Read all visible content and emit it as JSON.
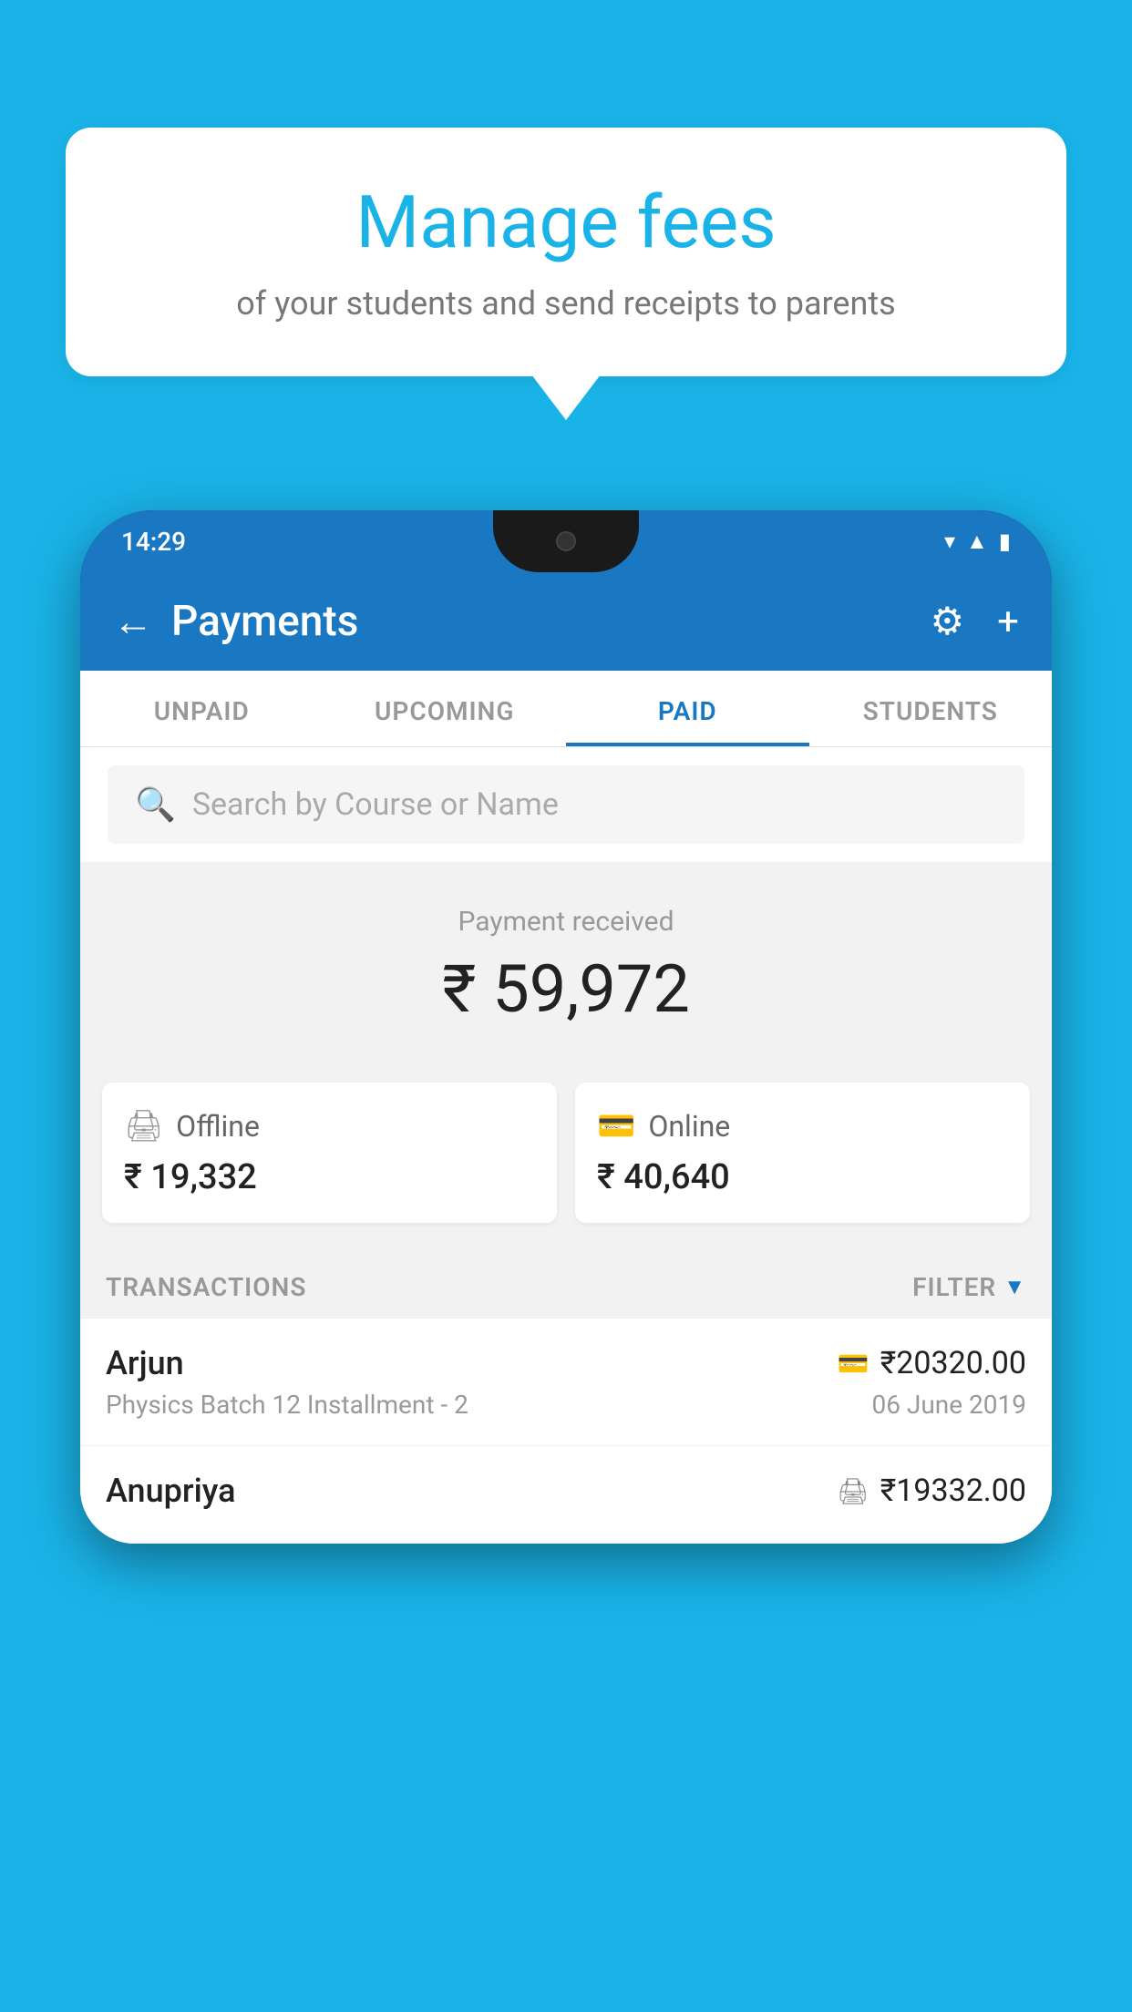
{
  "background_color": "#1ab3e8",
  "speech_bubble": {
    "title": "Manage fees",
    "subtitle": "of your students and send receipts to parents"
  },
  "status_bar": {
    "time": "14:29"
  },
  "header": {
    "title": "Payments",
    "back_label": "←",
    "settings_label": "⚙",
    "plus_label": "+"
  },
  "tabs": [
    {
      "label": "UNPAID",
      "active": false
    },
    {
      "label": "UPCOMING",
      "active": false
    },
    {
      "label": "PAID",
      "active": true
    },
    {
      "label": "STUDENTS",
      "active": false
    }
  ],
  "search": {
    "placeholder": "Search by Course or Name"
  },
  "payment_summary": {
    "label": "Payment received",
    "amount": "₹ 59,972",
    "offline_label": "Offline",
    "offline_amount": "₹ 19,332",
    "online_label": "Online",
    "online_amount": "₹ 40,640"
  },
  "transactions": {
    "section_label": "TRANSACTIONS",
    "filter_label": "FILTER",
    "rows": [
      {
        "name": "Arjun",
        "amount": "₹20320.00",
        "detail": "Physics Batch 12 Installment - 2",
        "date": "06 June 2019",
        "payment_type": "online"
      },
      {
        "name": "Anupriya",
        "amount": "₹19332.00",
        "detail": "",
        "date": "",
        "payment_type": "offline"
      }
    ]
  }
}
